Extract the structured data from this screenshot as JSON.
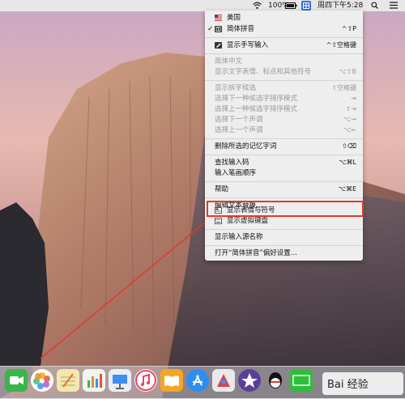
{
  "menubar": {
    "battery": "100%",
    "clock": "周四下午5:28"
  },
  "menu": {
    "items": [
      {
        "label": "美国",
        "shortcut": "",
        "icon": "us-flag-icon",
        "disabled": false
      },
      {
        "label": "简体拼音",
        "shortcut": "^⇧P",
        "icon": "pinyin-icon",
        "checked": true,
        "disabled": false
      },
      {
        "label": "显示手写输入",
        "shortcut": "^⇧空格键",
        "icon": "handwriting-icon",
        "disabled": false
      },
      {
        "label": "简体中文",
        "shortcut": "",
        "disabled": true
      },
      {
        "label": "显示文字表情、标点和其他符号",
        "shortcut": "⌥⇧B",
        "disabled": true
      },
      {
        "label": "显示拆字候选",
        "shortcut": "⇧空格键",
        "disabled": true
      },
      {
        "label": "选择下一种候选字排序模式",
        "shortcut": "⇥",
        "disabled": true
      },
      {
        "label": "选择上一种候选字排序模式",
        "shortcut": "⇧⇥",
        "disabled": true
      },
      {
        "label": "选择下一个声调",
        "shortcut": "⌥→",
        "disabled": true
      },
      {
        "label": "选择上一个声调",
        "shortcut": "⌥←",
        "disabled": true
      },
      {
        "label": "删除所选的记忆字词",
        "shortcut": "⇧⌫",
        "disabled": false
      },
      {
        "label": "查找输入码",
        "shortcut": "⌥⌘L",
        "disabled": false
      },
      {
        "label": "输入笔画顺序",
        "shortcut": "",
        "disabled": false
      },
      {
        "label": "帮助",
        "shortcut": "⌥⌘E",
        "disabled": false
      },
      {
        "label": "编辑文本替换...",
        "shortcut": "",
        "disabled": false
      },
      {
        "label": "显示表情与符号",
        "shortcut": "",
        "icon": "emoji-viewer-icon",
        "disabled": false
      },
      {
        "label": "显示虚拟键盘",
        "shortcut": "",
        "icon": "keyboard-icon",
        "disabled": false
      },
      {
        "label": "显示输入源名称",
        "shortcut": "",
        "disabled": false
      },
      {
        "label": "打开“简体拼音”偏好设置...",
        "shortcut": "",
        "disabled": false
      }
    ]
  },
  "dock": {
    "apps": [
      "facetime-icon",
      "photos-icon",
      "notes-icon",
      "numbers-icon",
      "keynote-icon",
      "itunes-icon",
      "ibooks-icon",
      "app-store-icon",
      "launcher-icon",
      "imovie-icon",
      "qq-icon",
      "iqiyi-icon"
    ]
  },
  "watermark": {
    "text": "Bai 经验"
  },
  "colors": {
    "highlight": "#e23a2a",
    "arrow": "#e23a2a"
  }
}
